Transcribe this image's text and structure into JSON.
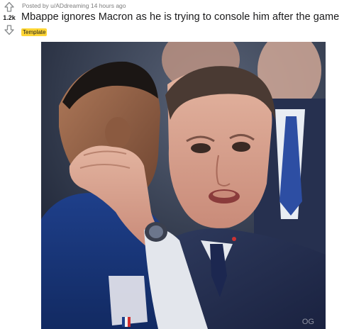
{
  "post": {
    "score": "1.2k",
    "posted_by_prefix": "Posted by ",
    "author": "u/ADdreaming",
    "time": "14 hours ago",
    "title": "Mbappe ignores Macron as he is trying to console him after the game",
    "flair": "Template",
    "flair_bg": "#ffd635",
    "flair_fg": "#1a1a1b"
  },
  "icons": {
    "upvote": "arrow-up-icon",
    "downvote": "arrow-down-icon"
  },
  "image": {
    "alt_subject": "photo",
    "watermark": "OG"
  }
}
